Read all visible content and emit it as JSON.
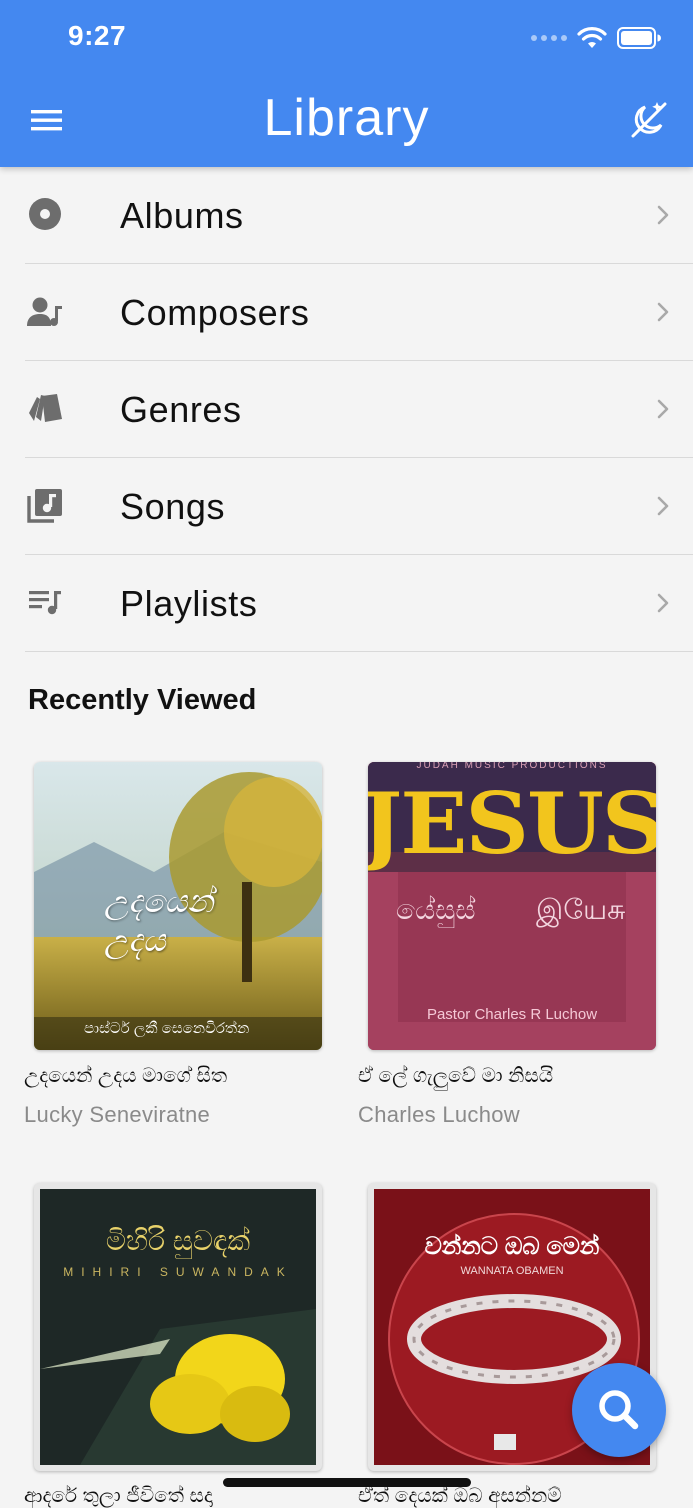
{
  "status": {
    "time": "9:27"
  },
  "header": {
    "title": "Library"
  },
  "menu": [
    {
      "label": "Albums",
      "icon": "album-icon"
    },
    {
      "label": "Composers",
      "icon": "composer-icon"
    },
    {
      "label": "Genres",
      "icon": "genres-icon"
    },
    {
      "label": "Songs",
      "icon": "songs-icon"
    },
    {
      "label": "Playlists",
      "icon": "playlist-icon"
    }
  ],
  "recent": {
    "title": "Recently Viewed",
    "items": [
      {
        "title": "උදයෙන් උදය මාගේ සිත",
        "artist": "Lucky Seneviratne",
        "cover_title": "උදයෙන් උදය",
        "cover_sub": "පාස්ටර් ලකී සෙනෙවිරත්න"
      },
      {
        "title": "ඒ ලේ ගැලුවේ මා නිසයි",
        "artist": "Charles Luchow",
        "cover_top": "JUDAH MUSIC PRODUCTIONS",
        "cover_title": "JESUS",
        "cover_sub1": "යේසුස්",
        "cover_sub2": "இயேசு",
        "cover_sub": "Pastor Charles R Luchow"
      },
      {
        "title": "ආදරේ තුලා ජීවිතේ සදා",
        "artist": "",
        "cover_title": "මිහිරි සුවඳක්",
        "cover_sub": "MIHIRI SUWANDAK"
      },
      {
        "title": "ඒත් දෙයක් ඔබ අසන්නම්",
        "artist": "",
        "cover_title": "වන්නට ඔබ මෙන්",
        "cover_sub": "WANNATA OBAMEN"
      }
    ]
  },
  "colors": {
    "primary": "#4488f0",
    "background": "#f4f4f4"
  }
}
